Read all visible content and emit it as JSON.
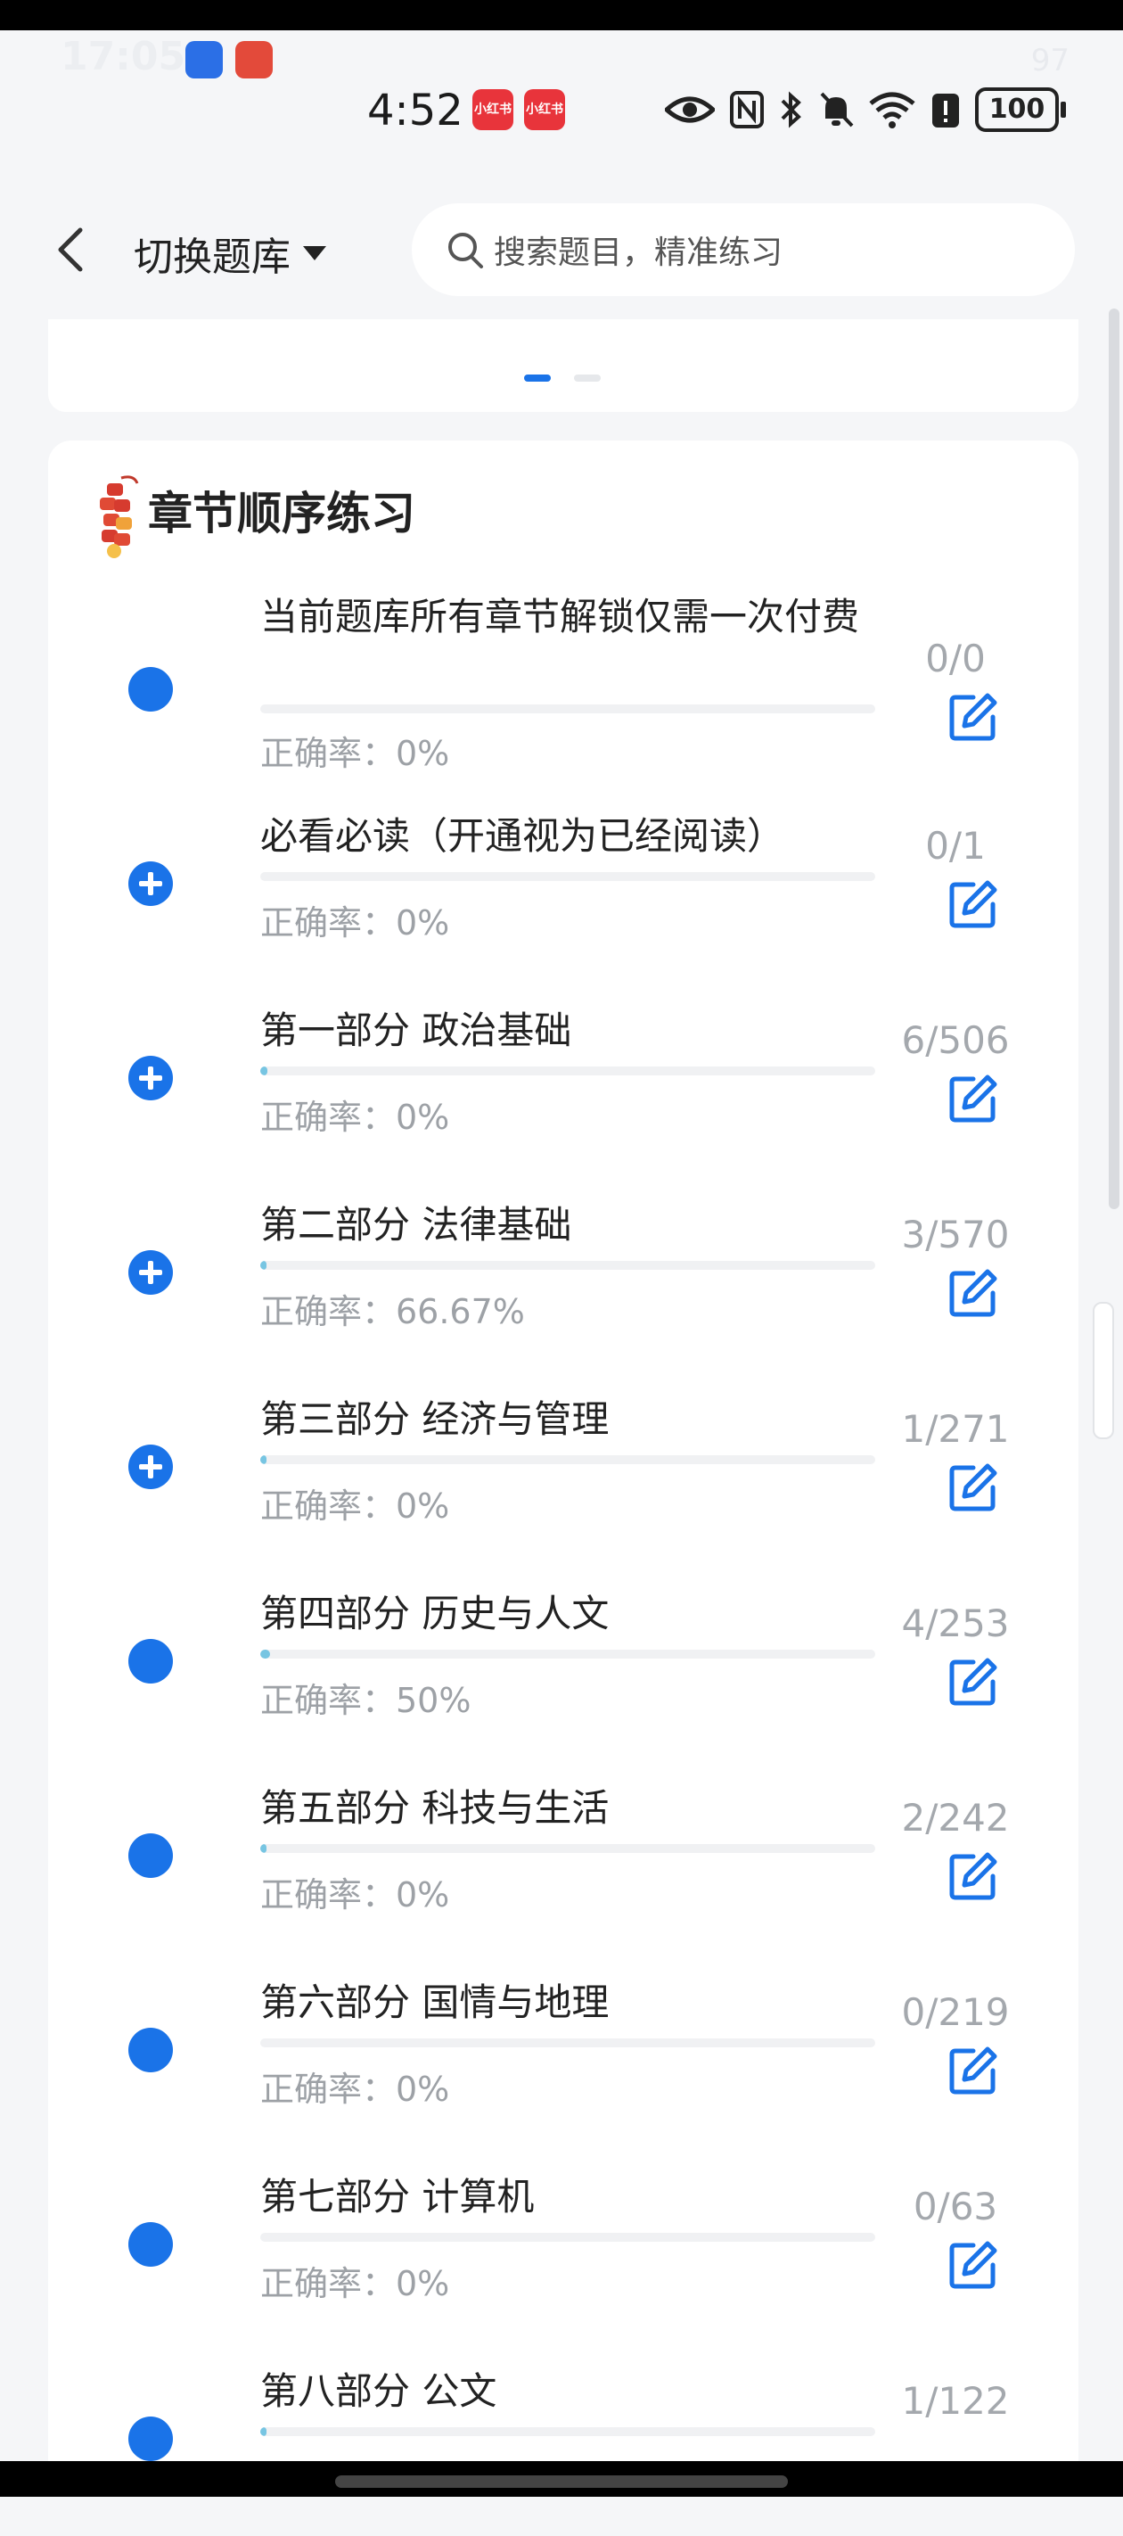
{
  "statusbar": {
    "ghost_time": "17:05",
    "ghost_battery": "97",
    "time": "4:52",
    "app_badge_1": "小红书",
    "app_badge_2": "小红书",
    "battery": "100"
  },
  "header": {
    "switch_label": "切换题库",
    "search_placeholder": "搜索题目，精准练习"
  },
  "section": {
    "title": "章节顺序练习"
  },
  "chapters": [
    {
      "title": "当前题库所有章节解锁仅需一次付费",
      "rate": "正确率：0%",
      "count": "0/0",
      "progress": 0,
      "expandable": false
    },
    {
      "title": "必看必读（开通视为已经阅读）",
      "rate": "正确率：0%",
      "count": "0/1",
      "progress": 0,
      "expandable": true
    },
    {
      "title": "第一部分 政治基础",
      "rate": "正确率：0%",
      "count": "6/506",
      "progress": 0.012,
      "expandable": true
    },
    {
      "title": "第二部分 法律基础",
      "rate": "正确率：66.67%",
      "count": "3/570",
      "progress": 0.005,
      "expandable": true
    },
    {
      "title": "第三部分 经济与管理",
      "rate": "正确率：0%",
      "count": "1/271",
      "progress": 0.004,
      "expandable": true
    },
    {
      "title": "第四部分 历史与人文",
      "rate": "正确率：50%",
      "count": "4/253",
      "progress": 0.016,
      "expandable": false
    },
    {
      "title": "第五部分 科技与生活",
      "rate": "正确率：0%",
      "count": "2/242",
      "progress": 0.008,
      "expandable": false
    },
    {
      "title": "第六部分 国情与地理",
      "rate": "正确率：0%",
      "count": "0/219",
      "progress": 0,
      "expandable": false
    },
    {
      "title": "第七部分 计算机",
      "rate": "正确率：0%",
      "count": "0/63",
      "progress": 0,
      "expandable": false
    },
    {
      "title": "第八部分 公文",
      "rate": "",
      "count": "1/122",
      "progress": 0.008,
      "expandable": false
    }
  ],
  "colors": {
    "accent": "#1a73e8",
    "progress": "#77c5e2",
    "muted": "#9da1a6"
  }
}
